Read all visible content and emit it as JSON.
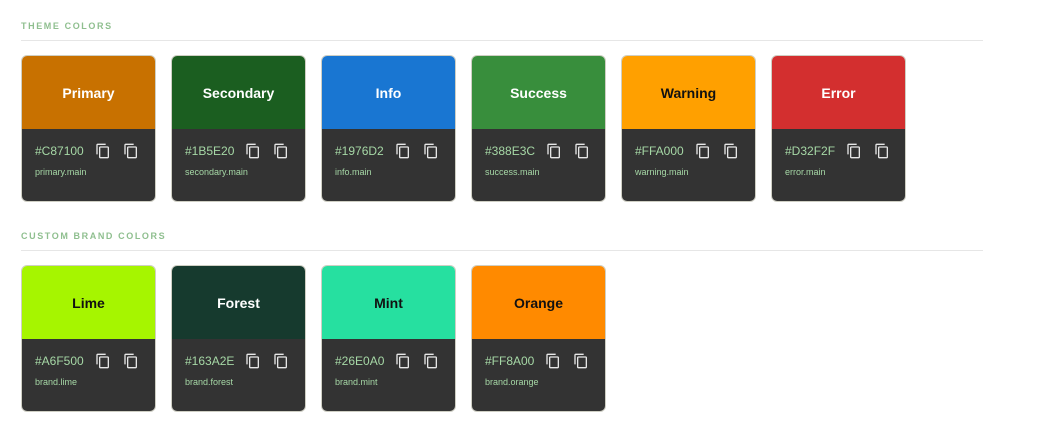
{
  "sections": [
    {
      "title": "THEME COLORS",
      "cards": [
        {
          "name": "Primary",
          "hex": "#C87100",
          "token": "primary.main",
          "bg": "#C87100",
          "fg": "#ffffff"
        },
        {
          "name": "Secondary",
          "hex": "#1B5E20",
          "token": "secondary.main",
          "bg": "#1B5E20",
          "fg": "#ffffff"
        },
        {
          "name": "Info",
          "hex": "#1976D2",
          "token": "info.main",
          "bg": "#1976D2",
          "fg": "#ffffff"
        },
        {
          "name": "Success",
          "hex": "#388E3C",
          "token": "success.main",
          "bg": "#388E3C",
          "fg": "#ffffff"
        },
        {
          "name": "Warning",
          "hex": "#FFA000",
          "token": "warning.main",
          "bg": "#FFA000",
          "fg": "#111111"
        },
        {
          "name": "Error",
          "hex": "#D32F2F",
          "token": "error.main",
          "bg": "#D32F2F",
          "fg": "#ffffff"
        }
      ]
    },
    {
      "title": "CUSTOM BRAND COLORS",
      "cards": [
        {
          "name": "Lime",
          "hex": "#A6F500",
          "token": "brand.lime",
          "bg": "#A6F500",
          "fg": "#111111"
        },
        {
          "name": "Forest",
          "hex": "#163A2E",
          "token": "brand.forest",
          "bg": "#163A2E",
          "fg": "#ffffff"
        },
        {
          "name": "Mint",
          "hex": "#26E0A0",
          "token": "brand.mint",
          "bg": "#26E0A0",
          "fg": "#111111"
        },
        {
          "name": "Orange",
          "hex": "#FF8A00",
          "token": "brand.orange",
          "bg": "#FF8A00",
          "fg": "#111111"
        }
      ]
    }
  ],
  "icons": {
    "copy": "copy-icon"
  },
  "colors": {
    "panel": "#333333",
    "text_accent": "#A6D8A6",
    "section_title": "#8FBF8F"
  }
}
